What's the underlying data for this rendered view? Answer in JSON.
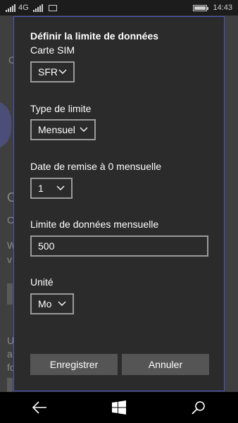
{
  "status_bar": {
    "network_type": "4G",
    "time": "14:43",
    "icons": [
      "signal-icon",
      "signal-icon",
      "message-icon",
      "battery-icon"
    ]
  },
  "background_fragments": [
    "C",
    "O",
    "C",
    "W",
    "v",
    "U",
    "a",
    "fo"
  ],
  "dialog": {
    "title": "Définir la limite de données",
    "sim_label": "Carte SIM",
    "sim_value": "SFR",
    "limit_type_label": "Type de limite",
    "limit_type_value": "Mensuel",
    "reset_date_label": "Date de remise à 0 mensuelle",
    "reset_date_value": "1",
    "monthly_limit_label": "Limite de données mensuelle",
    "monthly_limit_value": "500",
    "unit_label": "Unité",
    "unit_value": "Mo",
    "save_label": "Enregistrer",
    "cancel_label": "Annuler"
  },
  "navbar": {
    "icons": [
      "back-arrow-icon",
      "windows-start-icon",
      "search-icon"
    ]
  },
  "colors": {
    "dialog_background": "#2b2b2b",
    "dialog_border": "#4b56c8",
    "button_background": "#555555",
    "navbar_background": "#000000"
  }
}
